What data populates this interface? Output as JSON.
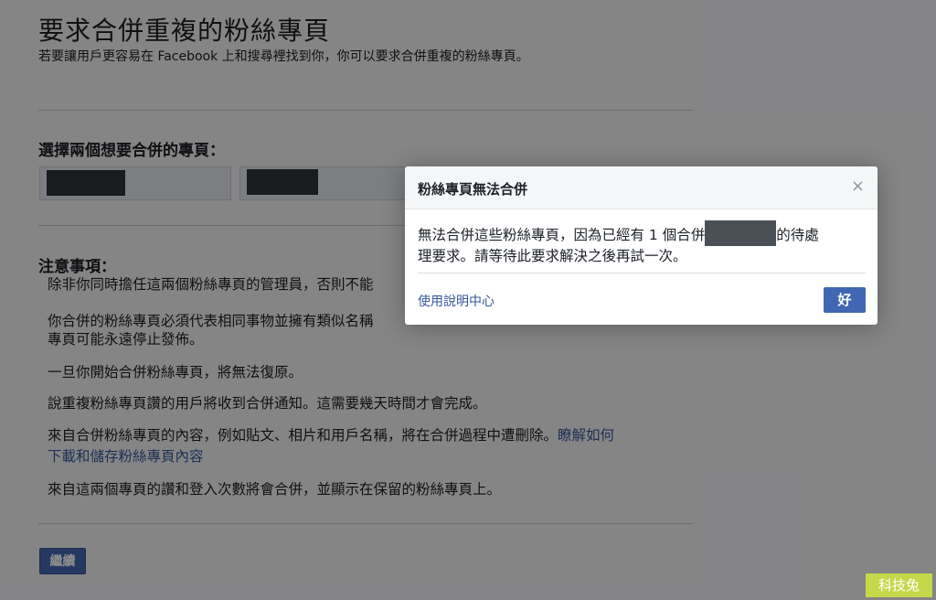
{
  "header": {
    "title": "要求合併重複的粉絲專頁",
    "subtitle": "若要讓用戶更容易在 Facebook 上和搜尋裡找到你，你可以要求合併重複的粉絲專頁。"
  },
  "select_section": {
    "title": "選擇兩個想要合併的專頁："
  },
  "notes": {
    "title": "注意事項：",
    "items": [
      "除非你同時擔任這兩個粉絲專頁的管理員，否則不能",
      "你合併的粉絲專頁必須代表相同事物並擁有類似名稱",
      "專頁可能永遠停止發佈。",
      "一旦你開始合併粉絲專頁，將無法復原。",
      "說重複粉絲專頁讚的用戶將收到合併通知。這需要幾天時間才會完成。",
      "來自合併粉絲專頁的內容，例如貼文、相片和用戶名稱，將在合併過程中遭刪除。",
      "瞭解如何",
      "下載和儲存粉絲專頁內容",
      "來自這兩個專頁的讚和登入次數將會合併，並顯示在保留的粉絲專頁上。"
    ]
  },
  "continue_label": "繼續",
  "dialog": {
    "title": "粉絲專頁無法合併",
    "close_icon": "×",
    "body_before": "無法合併這些粉絲專頁，因為已經有 1 個合併",
    "body_after": "的待處",
    "body_line2": "理要求。請等待此要求解決之後再試一次。",
    "help_link": "使用說明中心",
    "ok_label": "好"
  },
  "watermark": "科技兔",
  "colors": {
    "primary_button": "#4267b2",
    "link": "#385898",
    "watermark_bg": "#c4d84a"
  }
}
